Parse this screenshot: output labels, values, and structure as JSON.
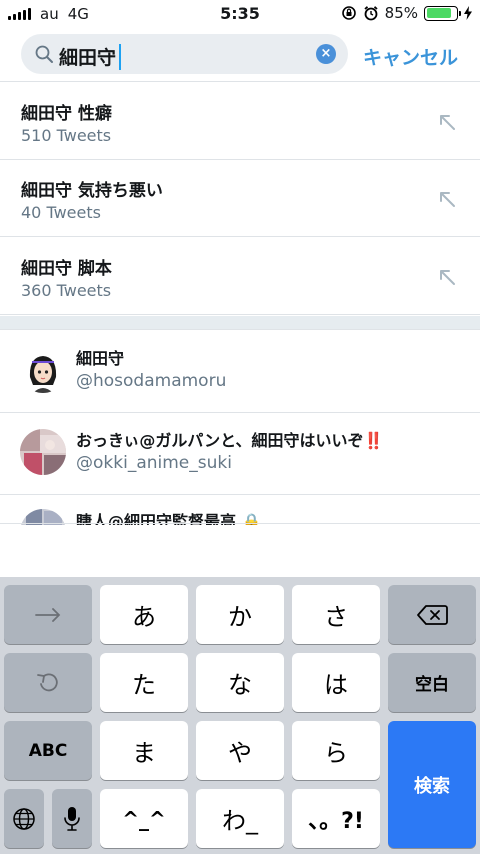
{
  "status_bar": {
    "carrier": "au",
    "network": "4G",
    "time": "5:35",
    "battery_percent": "85%",
    "battery_level": 0.85,
    "battery_color": "#4cd964"
  },
  "search": {
    "query": "細田守",
    "cancel_label": "キャンセル",
    "clear_icon": "×"
  },
  "suggestions": [
    {
      "term": "細田守 性癖",
      "count": "510 Tweets"
    },
    {
      "term": "細田守 気持ち悪い",
      "count": "40 Tweets"
    },
    {
      "term": "細田守 脚本",
      "count": "360 Tweets"
    }
  ],
  "users": [
    {
      "name": "細田守",
      "handle": "@hosodamamoru"
    },
    {
      "name": "おっきぃ@ガルパンと、細田守はいいぞ",
      "name_suffix": "‼️",
      "handle": "@okki_anime_suki"
    },
    {
      "name": "睫人@細田守監督最高 🔒",
      "handle": ""
    }
  ],
  "keyboard": {
    "row1": [
      "→",
      "あ",
      "か",
      "さ",
      "⌫"
    ],
    "row2": [
      "↺",
      "た",
      "な",
      "は",
      "空白"
    ],
    "row3": [
      "ABC",
      "ま",
      "や",
      "ら",
      "検索"
    ],
    "row4": [
      "🌐",
      "🎤",
      "^_^",
      "わ_",
      "、。?!"
    ]
  },
  "colors": {
    "accent": "#3b94d9",
    "search_key": "#2c79f5"
  }
}
